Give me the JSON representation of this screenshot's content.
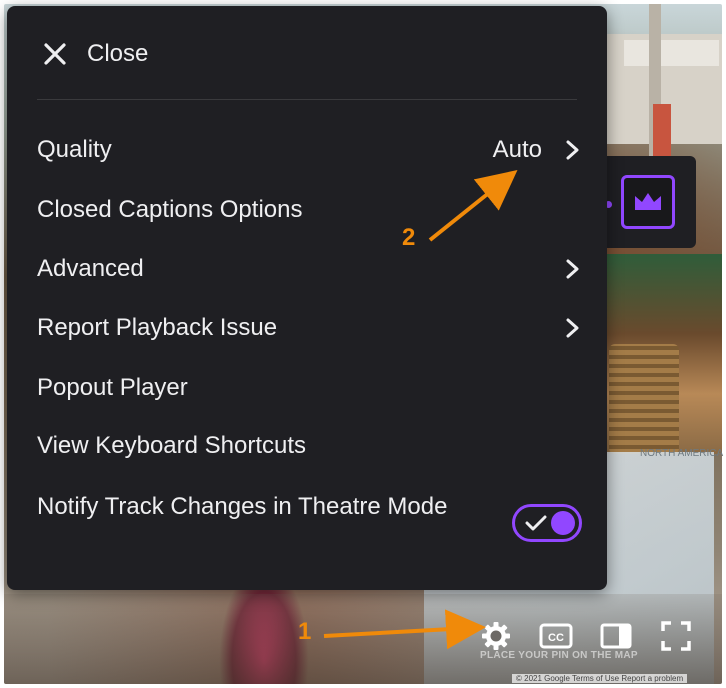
{
  "menu": {
    "close_label": "Close",
    "items": [
      {
        "label": "Quality",
        "value": "Auto",
        "has_submenu": true
      },
      {
        "label": "Closed Captions Options",
        "has_submenu": false
      },
      {
        "label": "Advanced",
        "has_submenu": true
      },
      {
        "label": "Report Playback Issue",
        "has_submenu": true
      },
      {
        "label": "Popout Player",
        "has_submenu": false
      },
      {
        "label": "View Keyboard Shortcuts",
        "has_submenu": false
      },
      {
        "label": "Notify Track Changes in Theatre Mode",
        "toggle": true,
        "toggle_state": "on"
      }
    ]
  },
  "controls": {
    "icons": [
      "gear-icon",
      "closed-captions-icon",
      "theatre-mode-icon",
      "fullscreen-icon"
    ],
    "cc_text": "CC"
  },
  "background": {
    "map_overlay_text": "PLACE YOUR PIN ON THE MAP",
    "map_region_label": "NORTH AMERICA",
    "map_footer": "© 2021 Google   Terms of Use   Report a problem"
  },
  "annotations": {
    "step1": "1",
    "step2": "2"
  },
  "colors": {
    "menu_bg": "#1f1f23",
    "accent": "#9147ff",
    "annotation": "#f08a0a",
    "text": "#efeff1"
  }
}
